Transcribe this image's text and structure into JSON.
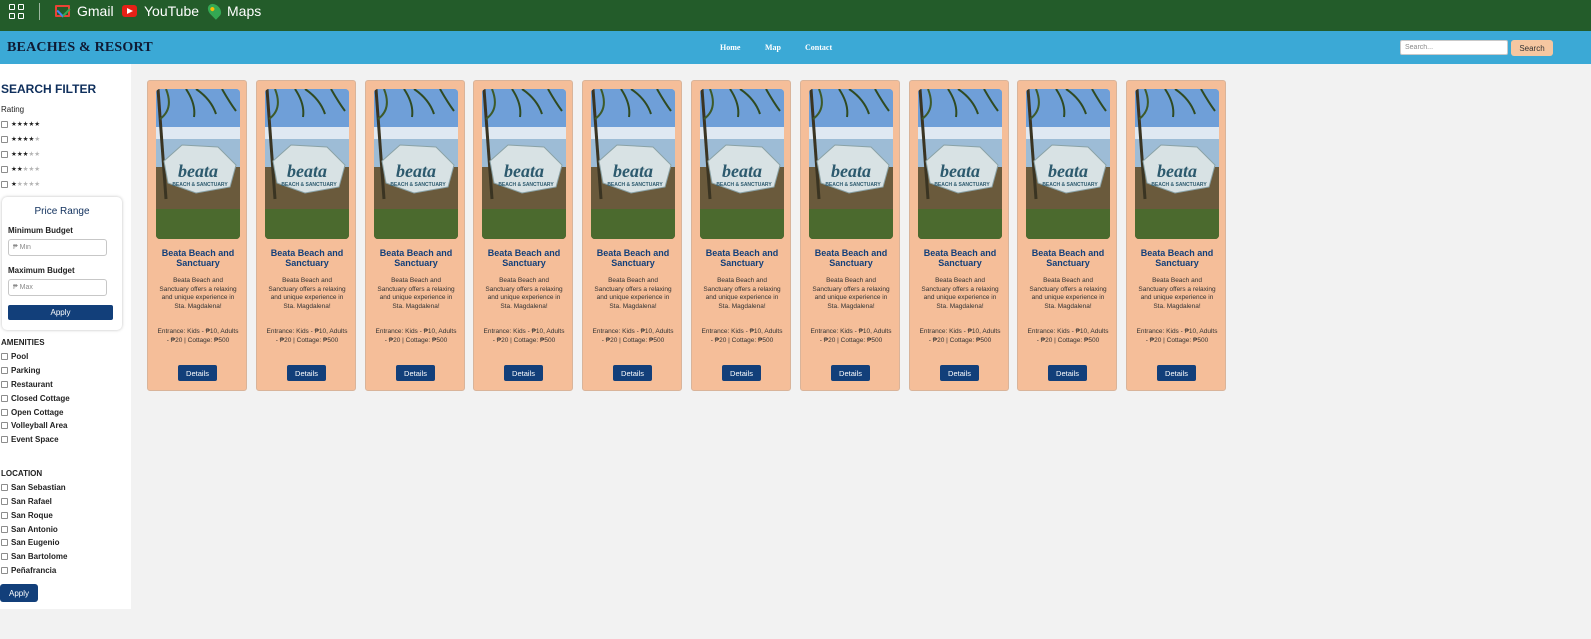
{
  "bookmarks": {
    "items": [
      {
        "label": "Gmail",
        "icon": "gmail-icon"
      },
      {
        "label": "YouTube",
        "icon": "youtube-icon"
      },
      {
        "label": "Maps",
        "icon": "maps-icon"
      }
    ]
  },
  "header": {
    "brand": "BEACHES & RESORT",
    "nav": [
      "Home",
      "Map",
      "Contact"
    ],
    "search_placeholder": "Search...",
    "search_button": "Search",
    "color": "#3ba9d6"
  },
  "sidebar": {
    "title": "SEARCH FILTER",
    "rating_label": "Rating",
    "ratings": [
      5,
      4,
      3,
      2,
      1
    ],
    "price": {
      "title": "Price Range",
      "min_label": "Minimum Budget",
      "min_placeholder": "₱ Min",
      "max_label": "Maximum Budget",
      "max_placeholder": "₱ Max",
      "apply": "Apply"
    },
    "amenities_title": "AMENITIES",
    "amenities": [
      "Pool",
      "Parking",
      "Restaurant",
      "Closed Cottage",
      "Open Cottage",
      "Volleyball Area",
      "Event Space"
    ],
    "location_title": "LOCATION",
    "locations": [
      "San Sebastian",
      "San Rafael",
      "San Roque",
      "San Antonio",
      "San Eugenio",
      "San Bartolome",
      "Peñafrancia"
    ],
    "apply": "Apply"
  },
  "cards": [
    {
      "title": "Beata Beach and Sanctuary",
      "desc": "Beata Beach and Sanctuary offers a relaxing and unique experience in Sta. Magdalena!",
      "price": "Entrance: Kids - ₱10, Adults - ₱20 | Cottage: ₱500",
      "button": "Details",
      "image_text": "beata",
      "image_subtext": "BEACH & SANCTUARY"
    },
    {
      "title": "Beata Beach and Sanctuary",
      "desc": "Beata Beach and Sanctuary offers a relaxing and unique experience in Sta. Magdalena!",
      "price": "Entrance: Kids - ₱10, Adults - ₱20 | Cottage: ₱500",
      "button": "Details",
      "image_text": "beata",
      "image_subtext": "BEACH & SANCTUARY"
    },
    {
      "title": "Beata Beach and Sanctuary",
      "desc": "Beata Beach and Sanctuary offers a relaxing and unique experience in Sta. Magdalena!",
      "price": "Entrance: Kids - ₱10, Adults - ₱20 | Cottage: ₱500",
      "button": "Details",
      "image_text": "beata",
      "image_subtext": "BEACH & SANCTUARY"
    },
    {
      "title": "Beata Beach and Sanctuary",
      "desc": "Beata Beach and Sanctuary offers a relaxing and unique experience in Sta. Magdalena!",
      "price": "Entrance: Kids - ₱10, Adults - ₱20 | Cottage: ₱500",
      "button": "Details",
      "image_text": "beata",
      "image_subtext": "BEACH & SANCTUARY"
    },
    {
      "title": "Beata Beach and Sanctuary",
      "desc": "Beata Beach and Sanctuary offers a relaxing and unique experience in Sta. Magdalena!",
      "price": "Entrance: Kids - ₱10, Adults - ₱20 | Cottage: ₱500",
      "button": "Details",
      "image_text": "beata",
      "image_subtext": "BEACH & SANCTUARY"
    },
    {
      "title": "Beata Beach and Sanctuary",
      "desc": "Beata Beach and Sanctuary offers a relaxing and unique experience in Sta. Magdalena!",
      "price": "Entrance: Kids - ₱10, Adults - ₱20 | Cottage: ₱500",
      "button": "Details",
      "image_text": "beata",
      "image_subtext": "BEACH & SANCTUARY"
    },
    {
      "title": "Beata Beach and Sanctuary",
      "desc": "Beata Beach and Sanctuary offers a relaxing and unique experience in Sta. Magdalena!",
      "price": "Entrance: Kids - ₱10, Adults - ₱20 | Cottage: ₱500",
      "button": "Details",
      "image_text": "beata",
      "image_subtext": "BEACH & SANCTUARY"
    },
    {
      "title": "Beata Beach and Sanctuary",
      "desc": "Beata Beach and Sanctuary offers a relaxing and unique experience in Sta. Magdalena!",
      "price": "Entrance: Kids - ₱10, Adults - ₱20 | Cottage: ₱500",
      "button": "Details",
      "image_text": "beata",
      "image_subtext": "BEACH & SANCTUARY"
    },
    {
      "title": "Beata Beach and Sanctuary",
      "desc": "Beata Beach and Sanctuary offers a relaxing and unique experience in Sta. Magdalena!",
      "price": "Entrance: Kids - ₱10, Adults - ₱20 | Cottage: ₱500",
      "button": "Details",
      "image_text": "beata",
      "image_subtext": "BEACH & SANCTUARY"
    },
    {
      "title": "Beata Beach and Sanctuary",
      "desc": "Beata Beach and Sanctuary offers a relaxing and unique experience in Sta. Magdalena!",
      "price": "Entrance: Kids - ₱10, Adults - ₱20 | Cottage: ₱500",
      "button": "Details",
      "image_text": "beata",
      "image_subtext": "BEACH & SANCTUARY"
    }
  ]
}
